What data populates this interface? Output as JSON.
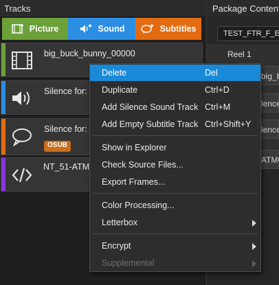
{
  "left_panel": {
    "title": "Tracks",
    "add_buttons": {
      "picture": "Picture",
      "sound": "Sound",
      "subtitles": "Subtitles"
    },
    "tracks": [
      {
        "label": "big_buck_bunny_00000",
        "icon": "film-icon",
        "color": "#6ca13a"
      },
      {
        "label": "Silence for: b",
        "icon": "speaker-icon",
        "color": "#2c8ee3"
      },
      {
        "label": "Silence for: b",
        "badge": "OSUB",
        "icon": "speech-bubble-icon",
        "color": "#e36b12"
      },
      {
        "label": "NT_51-ATMOS",
        "icon": "code-icon",
        "color": "#8a35e0"
      }
    ]
  },
  "right_panel": {
    "title": "Package Content",
    "cpl_name": "TEST_FTR_F_EN",
    "reel_label": "Reel 1",
    "fragments": [
      "big_b",
      "lence",
      "lence",
      "ATMC"
    ]
  },
  "context_menu": {
    "items": [
      {
        "label": "Delete",
        "shortcut": "Del",
        "highlighted": true
      },
      {
        "label": "Duplicate",
        "shortcut": "Ctrl+D"
      },
      {
        "label": "Add Silence Sound Track",
        "shortcut": "Ctrl+M"
      },
      {
        "label": "Add Empty Subtitle Track",
        "shortcut": "Ctrl+Shift+Y"
      },
      {
        "label": "Show in Explorer"
      },
      {
        "label": "Check Source Files..."
      },
      {
        "label": "Export Frames..."
      },
      {
        "label": "Color Processing..."
      },
      {
        "label": "Letterbox",
        "submenu": true
      },
      {
        "label": "Encrypt",
        "submenu": true
      },
      {
        "label": "Supplemental",
        "submenu": true,
        "disabled": true
      }
    ]
  },
  "colors": {
    "picture": "#6ca13a",
    "sound": "#2c8ee3",
    "subtitles": "#e36b12",
    "metadata": "#8a35e0",
    "highlight": "#1a8ad8"
  }
}
